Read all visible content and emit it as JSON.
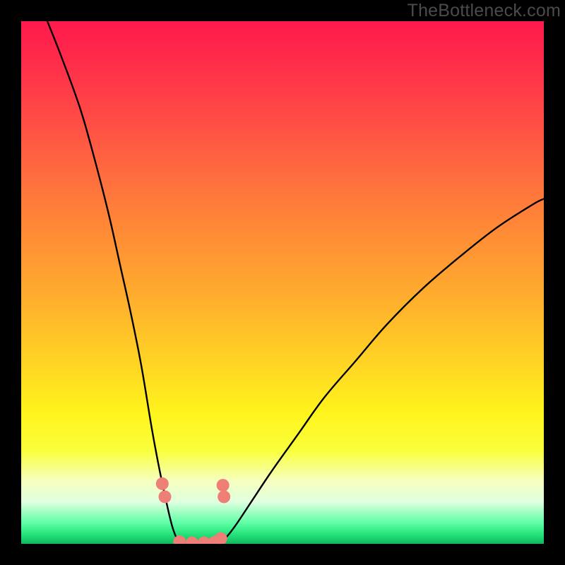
{
  "watermark": "TheBottleneck.com",
  "chart_data": {
    "type": "line",
    "title": "",
    "xlabel": "",
    "ylabel": "",
    "xlim": [
      0,
      100
    ],
    "ylim": [
      0,
      100
    ],
    "grid": false,
    "legend": false,
    "background_gradient": {
      "top": "#ff1a4d",
      "middle": "#fff41c",
      "bottom_band": "#17c96a"
    },
    "series": [
      {
        "name": "left-curve",
        "color": "#000000",
        "x": [
          5,
          7,
          10,
          12,
          15,
          17,
          19,
          21,
          23,
          25,
          26.5,
          28,
          29,
          30,
          30.5
        ],
        "y": [
          100,
          95,
          87,
          81,
          70,
          62,
          53,
          44,
          34,
          22,
          14,
          7,
          3,
          0.5,
          0
        ]
      },
      {
        "name": "flat-bottom",
        "color": "#000000",
        "x": [
          30.5,
          32,
          34,
          36,
          37.5
        ],
        "y": [
          0,
          0,
          0,
          0,
          0
        ]
      },
      {
        "name": "right-curve",
        "color": "#000000",
        "x": [
          37.5,
          39,
          41,
          44,
          48,
          53,
          58,
          64,
          70,
          77,
          84,
          91,
          98,
          100
        ],
        "y": [
          0,
          1,
          3.5,
          8,
          14,
          21,
          28,
          35,
          42,
          49,
          55,
          60.5,
          65,
          66
        ]
      }
    ],
    "markers": {
      "name": "salmon-dots",
      "color": "#ee7f76",
      "radius_px": 9,
      "points": [
        {
          "x": 27.0,
          "y": 11.5
        },
        {
          "x": 27.5,
          "y": 9.0
        },
        {
          "x": 30.3,
          "y": 0.4
        },
        {
          "x": 32.7,
          "y": 0.2
        },
        {
          "x": 35.0,
          "y": 0.2
        },
        {
          "x": 37.0,
          "y": 0.3
        },
        {
          "x": 38.2,
          "y": 1.0
        },
        {
          "x": 38.6,
          "y": 11.2
        },
        {
          "x": 38.8,
          "y": 9.0
        }
      ]
    }
  }
}
